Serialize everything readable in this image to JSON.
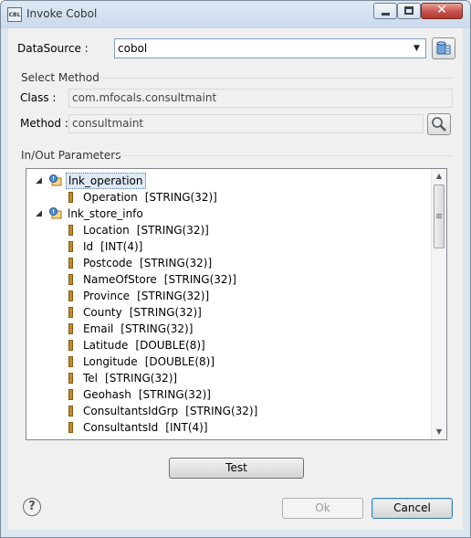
{
  "window": {
    "title": "Invoke Cobol",
    "app_icon_text": "CBL"
  },
  "datasource": {
    "label": "DataSource :",
    "value": "cobol"
  },
  "select_method": {
    "group_label": "Select Method",
    "class_label": "Class :",
    "class_value": "com.mfocals.consultmaint",
    "method_label": "Method :",
    "method_value": "consultmaint"
  },
  "params": {
    "group_label": "In/Out Parameters",
    "nodes": [
      {
        "label": "lnk_operation",
        "fields": [
          {
            "name": "Operation",
            "type": "[STRING(32)]"
          }
        ]
      },
      {
        "label": "lnk_store_info",
        "fields": [
          {
            "name": "Location",
            "type": "[STRING(32)]"
          },
          {
            "name": "Id",
            "type": "[INT(4)]"
          },
          {
            "name": "Postcode",
            "type": "[STRING(32)]"
          },
          {
            "name": "NameOfStore",
            "type": "[STRING(32)]"
          },
          {
            "name": "Province",
            "type": "[STRING(32)]"
          },
          {
            "name": "County",
            "type": "[STRING(32)]"
          },
          {
            "name": "Email",
            "type": "[STRING(32)]"
          },
          {
            "name": "Latitude",
            "type": "[DOUBLE(8)]"
          },
          {
            "name": "Longitude",
            "type": "[DOUBLE(8)]"
          },
          {
            "name": "Tel",
            "type": "[STRING(32)]"
          },
          {
            "name": "Geohash",
            "type": "[STRING(32)]"
          },
          {
            "name": "ConsultantsIdGrp",
            "type": "[STRING(32)]"
          },
          {
            "name": "ConsultantsId",
            "type": "[INT(4)]"
          }
        ]
      }
    ]
  },
  "buttons": {
    "test": "Test",
    "ok": "Ok",
    "cancel": "Cancel",
    "help": "?"
  },
  "colors": {
    "accent": "#3c7fb1",
    "selection": "#dfe9f5"
  }
}
